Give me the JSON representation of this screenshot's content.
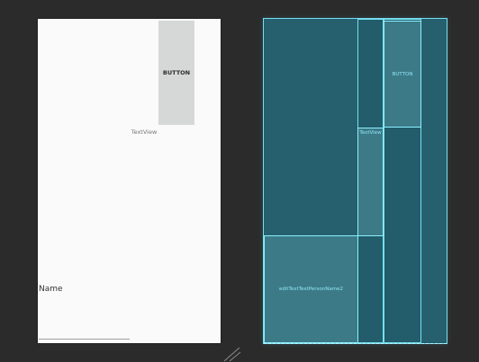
{
  "design": {
    "button_label": "BUTTON",
    "textview_label": "TextView",
    "edittext_text": "Name"
  },
  "blueprint": {
    "button_label": "BUTTON",
    "textview_label": "TextView",
    "edittext_id": "editTextTextPersonName2"
  },
  "colors": {
    "canvas_bg": "#2b2b2b",
    "design_surface": "#fafafa",
    "button_bg": "#d6d7d7",
    "blueprint_bg": "#26606e",
    "blueprint_outline": "#74dff0"
  },
  "icons": {
    "resize_handle": "diagonal-resize-icon"
  }
}
